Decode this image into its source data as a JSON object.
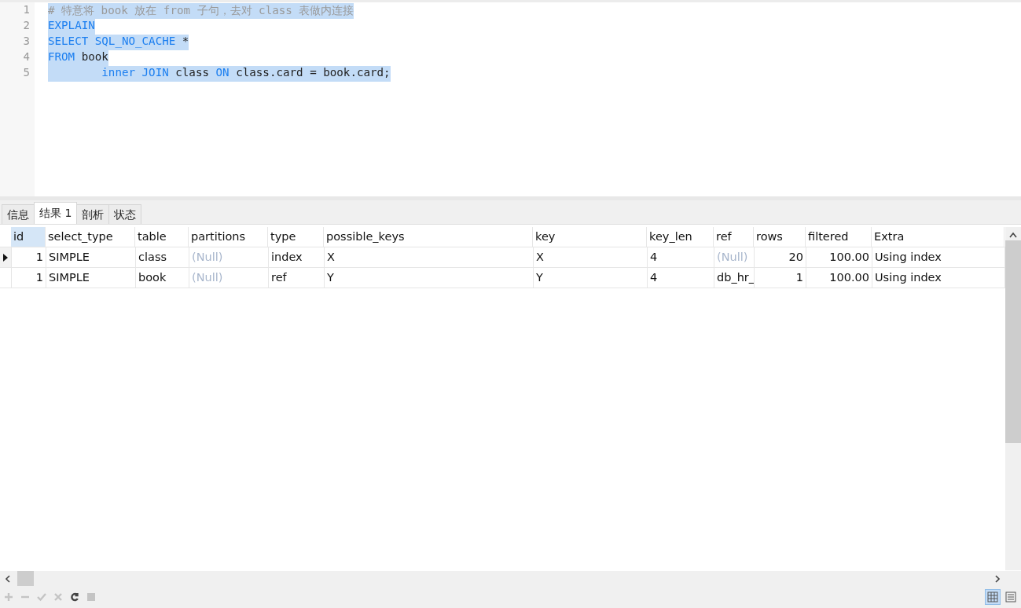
{
  "editor": {
    "lines": [
      {
        "number": "1",
        "tokens": [
          {
            "kind": "comment",
            "text": "# 特意将 book 放在 from 子句，去对 class 表做内连接"
          }
        ]
      },
      {
        "number": "2",
        "tokens": [
          {
            "kind": "keyword",
            "text": "EXPLAIN"
          }
        ]
      },
      {
        "number": "3",
        "tokens": [
          {
            "kind": "keyword",
            "text": "SELECT SQL_NO_CACHE"
          },
          {
            "kind": "plain",
            "text": " *"
          }
        ]
      },
      {
        "number": "4",
        "tokens": [
          {
            "kind": "keyword",
            "text": "FROM"
          },
          {
            "kind": "plain",
            "text": " book"
          }
        ]
      },
      {
        "number": "5",
        "tokens": [
          {
            "kind": "keyword",
            "text": "        inner JOIN"
          },
          {
            "kind": "plain",
            "text": " class "
          },
          {
            "kind": "keyword",
            "text": "ON"
          },
          {
            "kind": "plain",
            "text": " class.card = book.card;"
          }
        ]
      }
    ]
  },
  "tabs": [
    {
      "label": "信息",
      "selected": false
    },
    {
      "label": "结果 1",
      "selected": true
    },
    {
      "label": "剖析",
      "selected": false
    },
    {
      "label": "状态",
      "selected": false
    }
  ],
  "table": {
    "columns": [
      {
        "label": "id",
        "kind": "number",
        "selected": true
      },
      {
        "label": "select_type",
        "kind": "text",
        "selected": false
      },
      {
        "label": "table",
        "kind": "text",
        "selected": false
      },
      {
        "label": "partitions",
        "kind": "text",
        "selected": false
      },
      {
        "label": "type",
        "kind": "text",
        "selected": false
      },
      {
        "label": "possible_keys",
        "kind": "text",
        "selected": false
      },
      {
        "label": "key",
        "kind": "text",
        "selected": false
      },
      {
        "label": "key_len",
        "kind": "text",
        "selected": false
      },
      {
        "label": "ref",
        "kind": "text",
        "selected": false
      },
      {
        "label": "rows",
        "kind": "number",
        "selected": false
      },
      {
        "label": "filtered",
        "kind": "number",
        "selected": false
      },
      {
        "label": "Extra",
        "kind": "text",
        "selected": false
      }
    ],
    "rows": [
      {
        "selected": true,
        "cells": [
          {
            "text": "1",
            "null": false
          },
          {
            "text": "SIMPLE",
            "null": false
          },
          {
            "text": "class",
            "null": false
          },
          {
            "text": "(Null)",
            "null": true
          },
          {
            "text": "index",
            "null": false
          },
          {
            "text": "X",
            "null": false
          },
          {
            "text": "X",
            "null": false
          },
          {
            "text": "4",
            "null": false
          },
          {
            "text": "(Null)",
            "null": true
          },
          {
            "text": "20",
            "null": false
          },
          {
            "text": "100.00",
            "null": false
          },
          {
            "text": "Using index",
            "null": false
          }
        ]
      },
      {
        "selected": false,
        "cells": [
          {
            "text": "1",
            "null": false
          },
          {
            "text": "SIMPLE",
            "null": false
          },
          {
            "text": "book",
            "null": false
          },
          {
            "text": "(Null)",
            "null": true
          },
          {
            "text": "ref",
            "null": false
          },
          {
            "text": "Y",
            "null": false
          },
          {
            "text": "Y",
            "null": false
          },
          {
            "text": "4",
            "null": false
          },
          {
            "text": "db_hr_",
            "null": false
          },
          {
            "text": "1",
            "null": false
          },
          {
            "text": "100.00",
            "null": false
          },
          {
            "text": "Using index",
            "null": false
          }
        ]
      }
    ]
  },
  "toolbar": [
    {
      "kind": "add",
      "disabled": true
    },
    {
      "kind": "remove",
      "disabled": true
    },
    {
      "kind": "apply",
      "disabled": true
    },
    {
      "kind": "cancel",
      "disabled": true
    },
    {
      "kind": "refresh",
      "disabled": false
    },
    {
      "kind": "stop",
      "disabled": true
    }
  ],
  "views": [
    {
      "kind": "grid",
      "selected": true
    },
    {
      "kind": "form",
      "selected": false
    }
  ]
}
